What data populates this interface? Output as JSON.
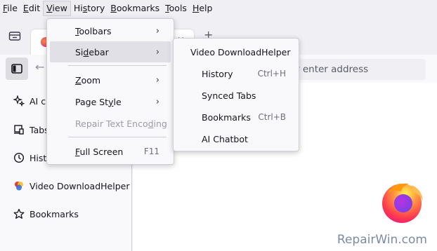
{
  "menubar": {
    "items": [
      {
        "label": "File",
        "u": "F",
        "rest": "ile"
      },
      {
        "label": "Edit",
        "u": "E",
        "rest": "dit"
      },
      {
        "label": "View",
        "u": "V",
        "rest": "iew"
      },
      {
        "label": "History",
        "u": "H",
        "pre": "",
        "rest": "istory"
      },
      {
        "label": "Bookmarks",
        "u": "B",
        "rest": "ookmarks"
      },
      {
        "label": "Tools",
        "u": "T",
        "rest": "ools"
      },
      {
        "label": "Help",
        "u": "H",
        "rest": "elp"
      }
    ],
    "history": {
      "pre": "Hi",
      "u": "s",
      "rest": "tory"
    }
  },
  "urlbar": {
    "placeholder": "r enter address"
  },
  "view_menu": {
    "toolbars": {
      "u": "T",
      "rest": "oolbars"
    },
    "sidebar": {
      "pre": "Si",
      "u": "d",
      "rest": "ebar"
    },
    "zoom": {
      "u": "Z",
      "rest": "oom"
    },
    "page_style": {
      "pre": "Page St",
      "u": "y",
      "rest": "le"
    },
    "repair": {
      "pre": "Repair Text Enco",
      "u": "d",
      "rest": "ing"
    },
    "full_screen": {
      "u": "F",
      "rest": "ull Screen",
      "shortcut": "F11"
    }
  },
  "sidebar_menu": {
    "items": [
      {
        "label": "Video DownloadHelper",
        "shortcut": ""
      },
      {
        "label": "History",
        "shortcut": "Ctrl+H"
      },
      {
        "label": "Synced Tabs",
        "shortcut": ""
      },
      {
        "label": "Bookmarks",
        "shortcut": "Ctrl+B"
      },
      {
        "label": "AI Chatbot",
        "shortcut": ""
      }
    ]
  },
  "sidebar": {
    "items": [
      {
        "label": "AI cl",
        "icon": "sparkle-icon"
      },
      {
        "label": "Tabs",
        "icon": "tabs-device-icon"
      },
      {
        "label": "Hist",
        "icon": "clock-icon"
      },
      {
        "label": "Video DownloadHelper",
        "icon": "video-downloadhelper-icon"
      },
      {
        "label": "Bookmarks",
        "icon": "star-icon"
      }
    ]
  },
  "tab": {
    "close_glyph": "×"
  },
  "watermark": "RepairWin.com",
  "colors": {
    "menu_highlight": "#e0e0e6",
    "sidebar_toggle_bg": "#dcdce1"
  }
}
